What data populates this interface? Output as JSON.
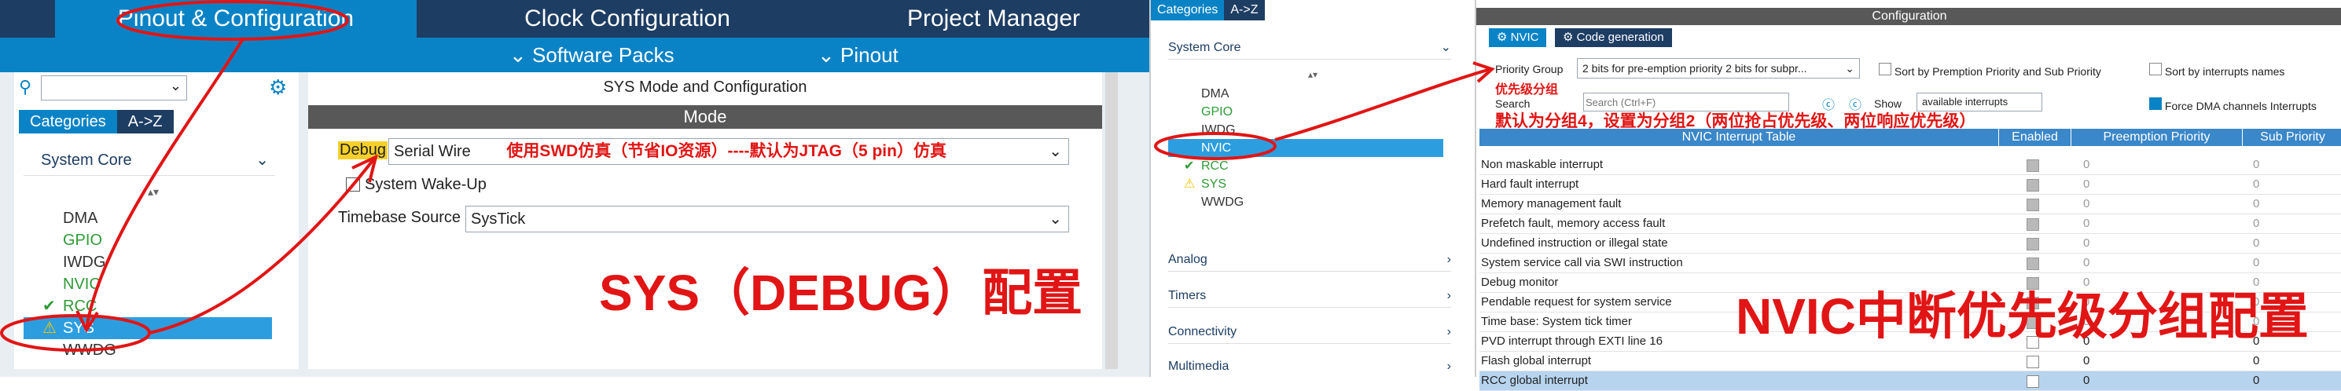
{
  "panel_a": {
    "tabs": [
      "Pinout & Configuration",
      "Clock Configuration",
      "Project Manager"
    ],
    "subtabs": [
      {
        "label": "Software Packs",
        "icon": "chevron-down-icon"
      },
      {
        "label": "Pinout",
        "icon": "chevron-down-icon"
      }
    ],
    "search_icon": "search-icon",
    "gear_icon": "gear-icon",
    "categories_tab": "Categories",
    "az_tab": "A->Z",
    "system_core_label": "System Core",
    "items": [
      {
        "label": "DMA",
        "style": "gray"
      },
      {
        "label": "GPIO",
        "style": "green"
      },
      {
        "label": "IWDG",
        "style": "gray"
      },
      {
        "label": "NVIC",
        "style": "green"
      },
      {
        "label": "RCC",
        "style": "green"
      },
      {
        "label": "SYS",
        "style": "selected"
      },
      {
        "label": "WWDG",
        "style": "gray"
      }
    ],
    "main_title": "SYS Mode and Configuration",
    "mode_header": "Mode",
    "debug_label": "Debug",
    "debug_value": "Serial Wire",
    "debug_note": "使用SWD仿真（节省IO资源）----默认为JTAG（5 pin）仿真",
    "wakeup_label": "System Wake-Up",
    "timebase_label": "Timebase Source",
    "timebase_value": "SysTick",
    "big_caption": "SYS（DEBUG）配置"
  },
  "panel_b": {
    "categories_tab": "Categories",
    "az_tab": "A->Z",
    "system_core_label": "System Core",
    "items": [
      {
        "label": "DMA",
        "style": "gray"
      },
      {
        "label": "GPIO",
        "style": "green"
      },
      {
        "label": "IWDG",
        "style": "gray"
      },
      {
        "label": "NVIC",
        "style": "selected"
      },
      {
        "label": "RCC",
        "style": "green"
      },
      {
        "label": "SYS",
        "style": "warn"
      },
      {
        "label": "WWDG",
        "style": "gray"
      }
    ],
    "groups": [
      "Analog",
      "Timers",
      "Connectivity",
      "Multimedia"
    ]
  },
  "panel_c": {
    "config_title": "Configuration",
    "tab_nvic": "NVIC",
    "tab_codegen": "Code generation",
    "priority_group_label": "Priority Group",
    "priority_group_value": "2 bits for pre-emption priority 2 bits for subpr...",
    "priority_note": "优先级分组",
    "sort_preemption": "Sort by Premption Priority and Sub Priority",
    "sort_interrupts": "Sort by interrupts names",
    "search_label": "Search",
    "search_placeholder": "Search (Ctrl+F)",
    "show_label": "Show",
    "show_value": "available interrupts",
    "force_dma": "Force DMA channels Interrupts",
    "group_note": "默认为分组4，设置为分组2（两位抢占优先级、两位响应优先级）",
    "table_headers": [
      "NVIC Interrupt Table",
      "Enabled",
      "Preemption Priority",
      "Sub Priority"
    ],
    "rows": [
      {
        "name": "Non maskable interrupt",
        "enabled": true,
        "pre": "0",
        "sub": "0"
      },
      {
        "name": "Hard fault interrupt",
        "enabled": true,
        "pre": "0",
        "sub": "0"
      },
      {
        "name": "Memory management fault",
        "enabled": true,
        "pre": "0",
        "sub": "0"
      },
      {
        "name": "Prefetch fault, memory access fault",
        "enabled": true,
        "pre": "0",
        "sub": "0"
      },
      {
        "name": "Undefined instruction or illegal state",
        "enabled": true,
        "pre": "0",
        "sub": "0"
      },
      {
        "name": "System service call via SWI instruction",
        "enabled": true,
        "pre": "0",
        "sub": "0"
      },
      {
        "name": "Debug monitor",
        "enabled": true,
        "pre": "0",
        "sub": "0"
      },
      {
        "name": "Pendable request for system service",
        "enabled": true,
        "pre": "0",
        "sub": "0"
      },
      {
        "name": "Time base: System tick timer",
        "enabled": true,
        "pre": "0",
        "sub": "0"
      },
      {
        "name": "PVD interrupt through EXTI line 16",
        "enabled": false,
        "pre": "0",
        "sub": "0"
      },
      {
        "name": "Flash global interrupt",
        "enabled": false,
        "pre": "0",
        "sub": "0"
      },
      {
        "name": "RCC global interrupt",
        "enabled": false,
        "pre": "0",
        "sub": "0"
      }
    ],
    "big_caption": "NVIC中断优先级分组配置"
  },
  "colors": {
    "accent": "#0a83c6",
    "dark_bar": "#1d3d63",
    "annotation_red": "#e11515",
    "selected": "#2c9ee0",
    "green": "#2e9a37"
  }
}
